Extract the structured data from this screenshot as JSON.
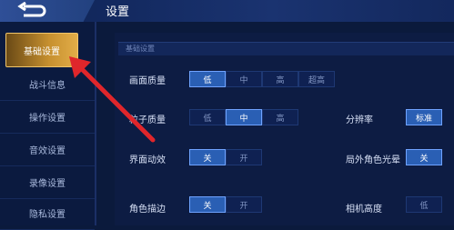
{
  "header": {
    "title": "设置",
    "back_icon": "back-arrow-icon"
  },
  "sidebar": {
    "items": [
      {
        "label": "基础设置",
        "active": true
      },
      {
        "label": "战斗信息"
      },
      {
        "label": "操作设置"
      },
      {
        "label": "音效设置"
      },
      {
        "label": "录像设置"
      },
      {
        "label": "隐私设置"
      }
    ]
  },
  "content": {
    "section_title": "基础设置",
    "rows": {
      "quality": {
        "label": "画面质量",
        "options": [
          "低",
          "中",
          "高",
          "超高"
        ],
        "selected": "低"
      },
      "particle": {
        "label": "粒子质量",
        "options": [
          "低",
          "中",
          "高"
        ],
        "selected": "中"
      },
      "resolution": {
        "label": "分辨率",
        "options": [
          "标准"
        ],
        "selected": "标准"
      },
      "ui_anim": {
        "label": "界面动效",
        "options": [
          "关",
          "开"
        ],
        "selected": "关"
      },
      "outside_glow": {
        "label": "局外角色光晕",
        "options": [
          "关"
        ],
        "selected": "关"
      },
      "outline": {
        "label": "角色描边",
        "options": [
          "关",
          "开"
        ],
        "selected": "关"
      },
      "camera": {
        "label": "相机高度",
        "options": [
          "低"
        ],
        "selected": ""
      }
    }
  },
  "annotation": {
    "arrow_color": "#e0262b"
  }
}
